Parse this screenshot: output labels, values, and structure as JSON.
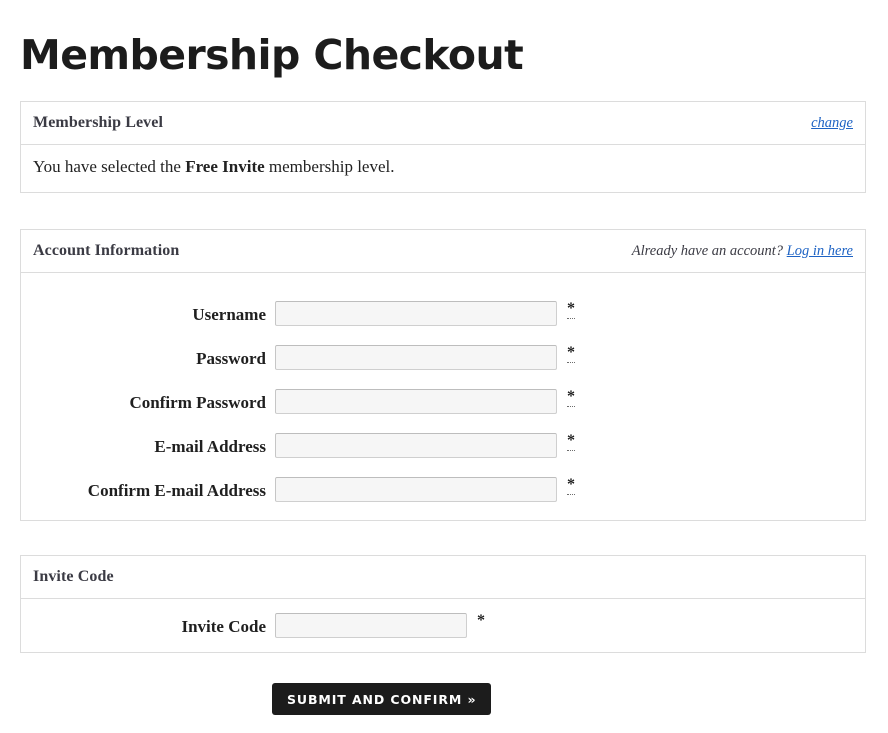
{
  "page": {
    "title": "Membership Checkout"
  },
  "membership_level": {
    "heading": "Membership Level",
    "change_link": "change",
    "sentence_prefix": "You have selected the ",
    "level_name": "Free Invite",
    "sentence_suffix": " membership level."
  },
  "account_information": {
    "heading": "Account Information",
    "login_prompt": "Already have an account?",
    "login_link": "Log in here",
    "required_marker": "*",
    "fields": [
      {
        "label": "Username",
        "value": "",
        "placeholder": "",
        "required": true
      },
      {
        "label": "Password",
        "value": "",
        "placeholder": "",
        "required": true
      },
      {
        "label": "Confirm Password",
        "value": "",
        "placeholder": "",
        "required": true
      },
      {
        "label": "E-mail Address",
        "value": "",
        "placeholder": "",
        "required": true
      },
      {
        "label": "Confirm E-mail Address",
        "value": "",
        "placeholder": "",
        "required": true
      }
    ]
  },
  "invite_code": {
    "heading": "Invite Code",
    "required_marker": "*",
    "fields": [
      {
        "label": "Invite Code",
        "value": "",
        "placeholder": "",
        "required": true
      }
    ]
  },
  "submit": {
    "label": "Submit and Confirm »"
  },
  "colors": {
    "link": "#1e63c4",
    "button_background": "#1c1c1c",
    "button_text": "#ffffff",
    "panel_border": "#dcdcdc",
    "input_background": "#f6f6f6",
    "heading_text": "#3b3b44"
  }
}
